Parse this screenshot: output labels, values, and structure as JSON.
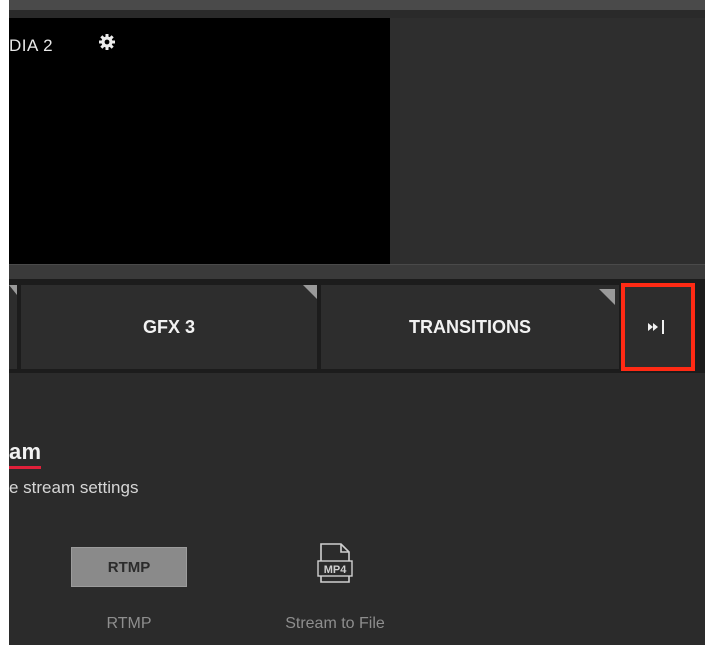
{
  "media": {
    "label": "DIA 2"
  },
  "tabs": {
    "gfx3": "GFX 3",
    "transitions": "TRANSITIONS"
  },
  "stream": {
    "title": "am",
    "subtitle": "e stream settings",
    "options": [
      {
        "badge": "RTMP",
        "label": "RTMP",
        "icon": "rtmp-badge"
      },
      {
        "badge": "MP4",
        "label": "Stream to File",
        "icon": "mp4-file-icon"
      }
    ]
  },
  "colors": {
    "highlight": "#ff2a14",
    "underline": "#e0203a"
  },
  "icons": {
    "settings": "gear-icon",
    "next": "skip-forward-icon"
  }
}
